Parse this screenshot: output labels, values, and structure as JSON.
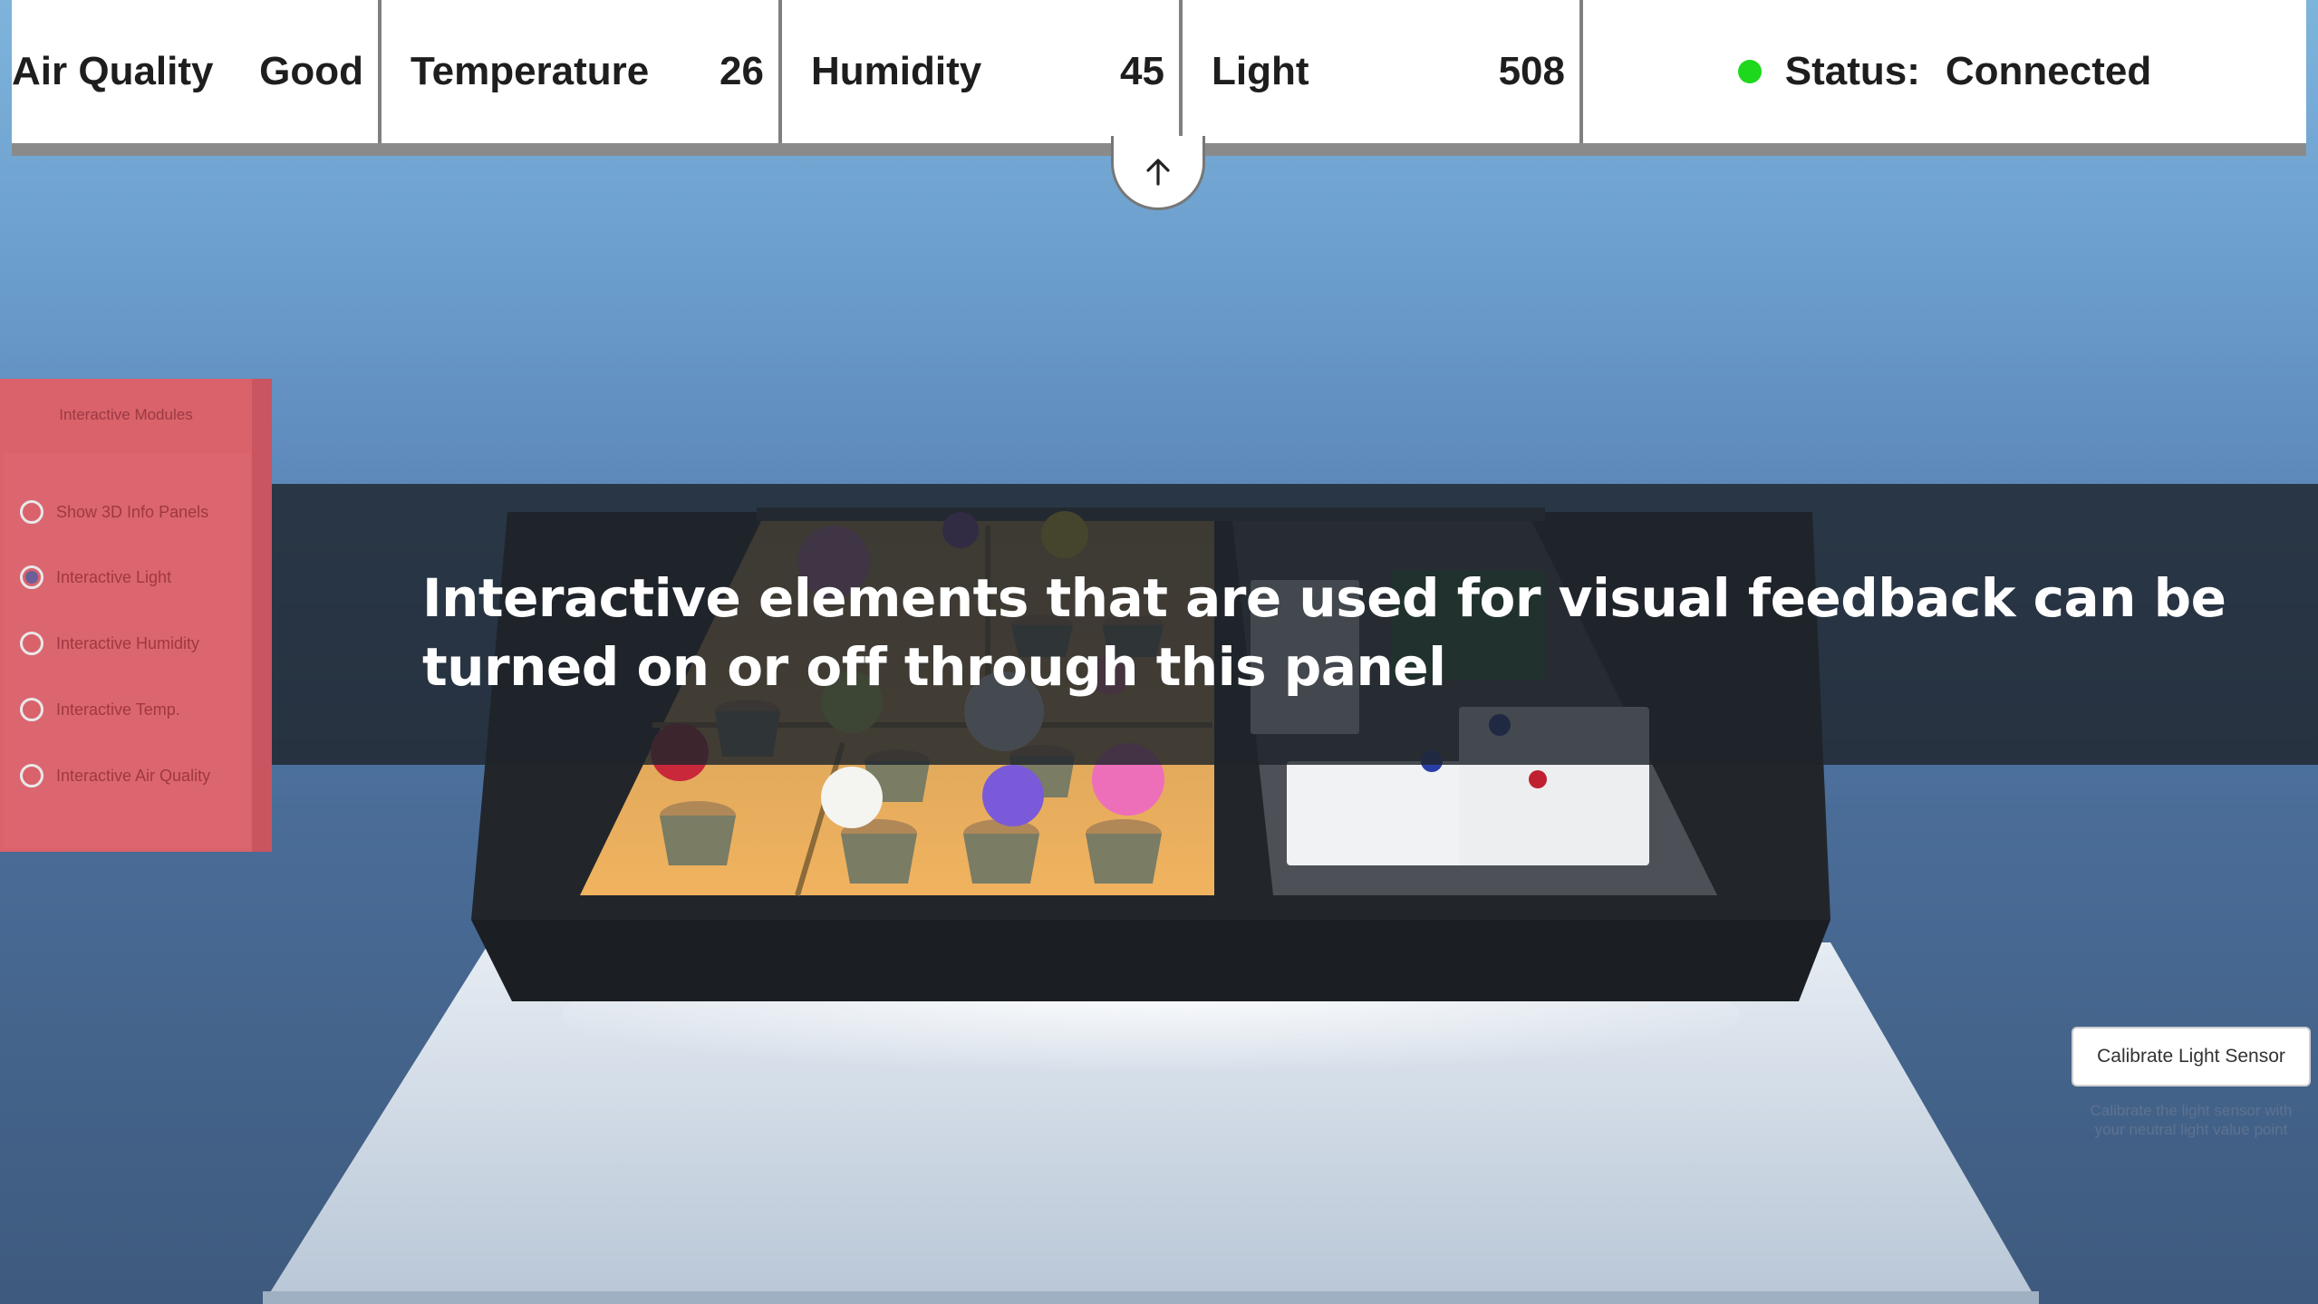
{
  "sensors": {
    "air_quality": {
      "label": "Air Quality",
      "value": "Good"
    },
    "temperature": {
      "label": "Temperature",
      "value": "26"
    },
    "humidity": {
      "label": "Humidity",
      "value": "45"
    },
    "light": {
      "label": "Light",
      "value": "508"
    },
    "status": {
      "label": "Status:",
      "value": "Connected",
      "color": "#1ed81e"
    }
  },
  "collapse_icon": "arrow-up-icon",
  "modules_panel": {
    "title": "Interactive Modules",
    "options": [
      {
        "label": "Show 3D Info Panels",
        "checked": false
      },
      {
        "label": "Interactive Light",
        "checked": true
      },
      {
        "label": "Interactive Humidity",
        "checked": false
      },
      {
        "label": "Interactive Temp.",
        "checked": false
      },
      {
        "label": "Interactive Air Quality",
        "checked": false
      }
    ]
  },
  "tutorial": {
    "text": "Interactive elements that are used for visual feedback can be turned on or off through this panel"
  },
  "calibrate": {
    "button_label": "Calibrate Light Sensor",
    "hint_line1": "Calibrate the light sensor with",
    "hint_line2": "your neutral light value point"
  },
  "colors": {
    "panel": "#d9626b",
    "status_dot": "#1ed81e",
    "overlay": "#1e242c"
  }
}
